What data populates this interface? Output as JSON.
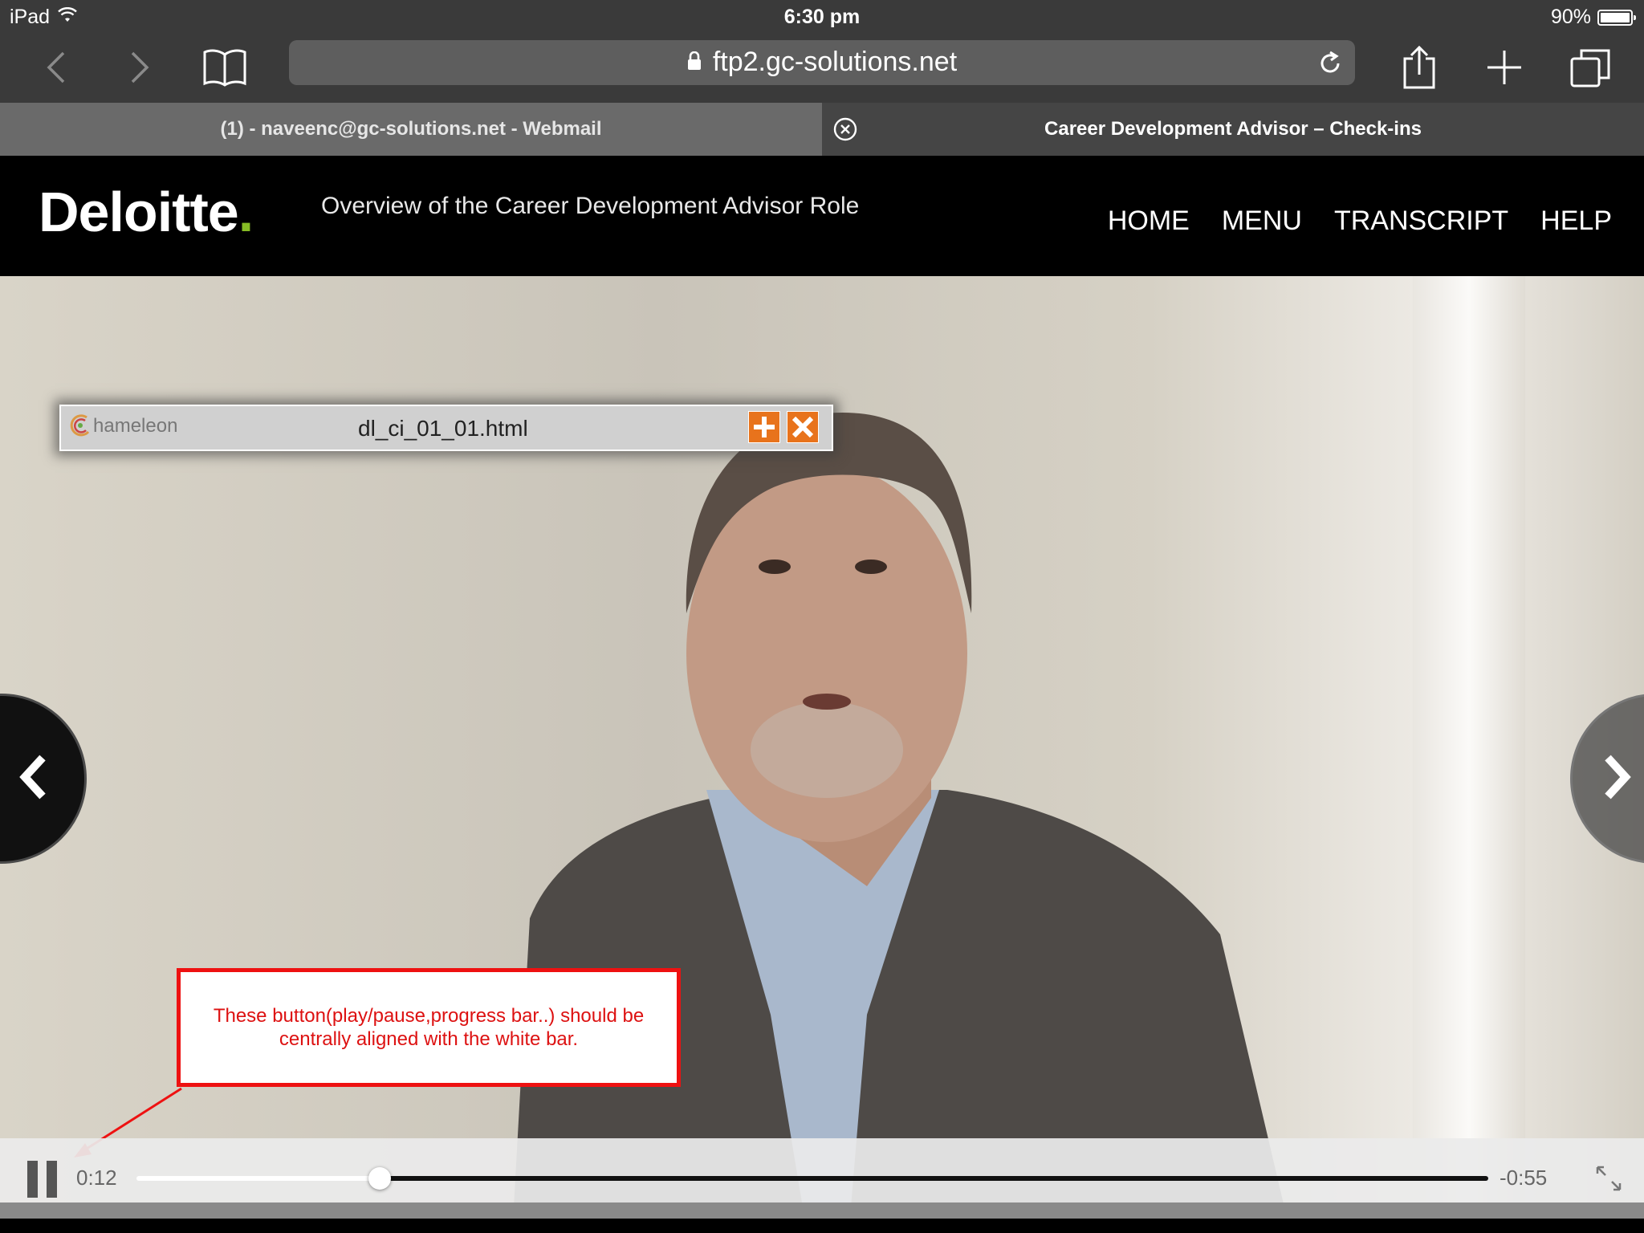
{
  "status_bar": {
    "device": "iPad",
    "time": "6:30 pm",
    "battery": "90%"
  },
  "browser": {
    "url": "ftp2.gc-solutions.net",
    "tabs": [
      {
        "label": "(1) - naveenc@gc-solutions.net - Webmail"
      },
      {
        "label": "Career Development Advisor – Check-ins"
      }
    ]
  },
  "site": {
    "logo": "Deloitte",
    "logo_dot": ".",
    "subtitle": "Overview of the Career Development Advisor Role",
    "nav": [
      "HOME",
      "MENU",
      "TRANSCRIPT",
      "HELP"
    ]
  },
  "popup": {
    "brand": "hameleon",
    "filename": "dl_ci_01_01.html"
  },
  "annotation": {
    "text": "These button(play/pause,progress bar..) should be centrally aligned with the white bar."
  },
  "player": {
    "current_time": "0:12",
    "remaining_time": "-0:55",
    "progress": 0.18
  },
  "colors": {
    "accent_green": "#86bc25",
    "annotation_red": "#e11111",
    "chrome_bg": "#3a3a3a"
  }
}
